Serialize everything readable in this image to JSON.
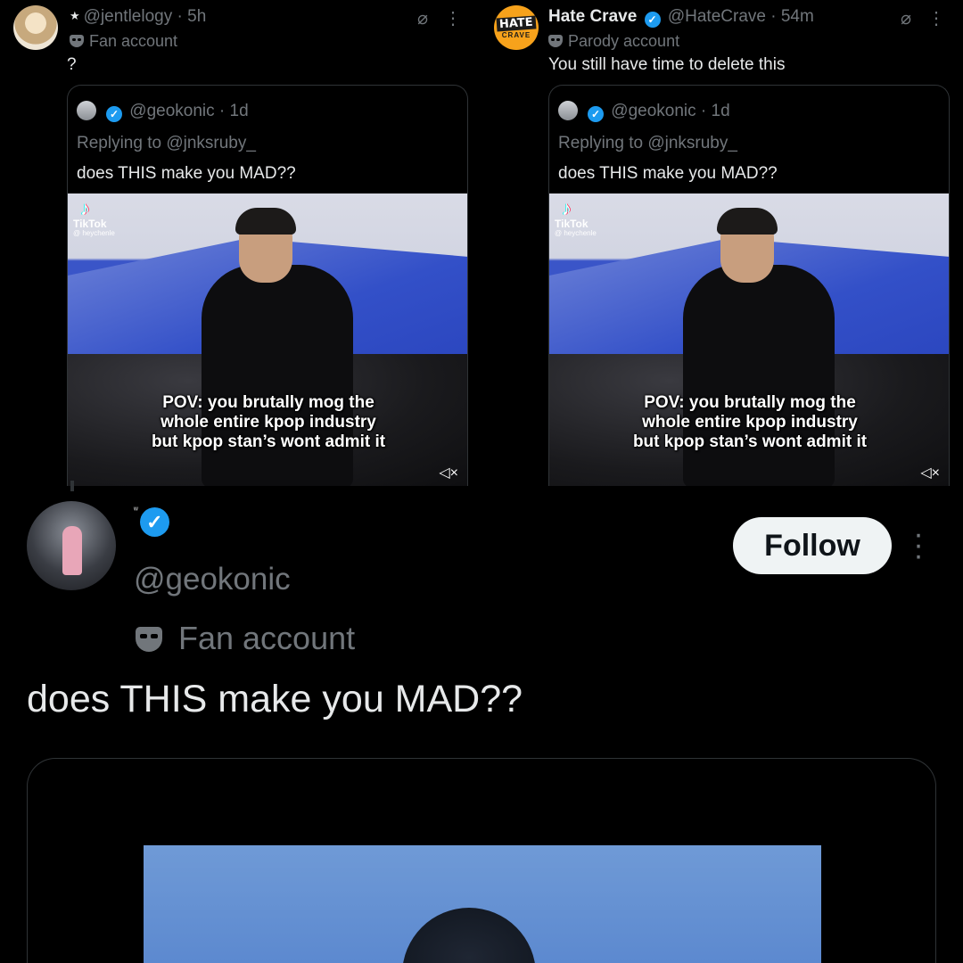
{
  "tweets": [
    {
      "display_name": "",
      "handle": "@jentlelogy",
      "time": "5h",
      "account_label": "Fan account",
      "text": "?",
      "quote": {
        "handle": "@geokonic",
        "time": "1d",
        "replying_to": "Replying to @jnksruby_",
        "text": "does THIS make you MAD??",
        "media": {
          "watermark_app": "TikTok",
          "watermark_handle": "@ heychenle",
          "caption_lines": [
            "POV: you brutally mog the",
            "whole entire kpop industry",
            "but kpop stan’s wont admit it"
          ]
        }
      }
    },
    {
      "display_name": "Hate Crave",
      "handle": "@HateCrave",
      "time": "54m",
      "account_label": "Parody account",
      "text": "You still have time to delete this",
      "logo_text": [
        "HATE",
        "CRAVE"
      ],
      "quote": {
        "handle": "@geokonic",
        "time": "1d",
        "replying_to": "Replying to @jnksruby_",
        "text": "does THIS make you MAD??",
        "media": {
          "watermark_app": "TikTok",
          "watermark_handle": "@ heychenle",
          "caption_lines": [
            "POV: you brutally mog the",
            "whole entire kpop industry",
            "but kpop stan’s wont admit it"
          ]
        }
      }
    }
  ],
  "main_tweet": {
    "handle": "@geokonic",
    "account_label": "Fan account",
    "text": "does THIS make you MAD??",
    "follow_label": "Follow"
  },
  "icons": {
    "grok": "⌀",
    "more": "⋮",
    "mute": "🔇",
    "verified": "✓"
  },
  "colors": {
    "background": "#000000",
    "text_primary": "#e7e9ea",
    "text_secondary": "#71767b",
    "verified": "#1d9bf0",
    "follow_bg": "#eff3f4",
    "hatecrave_brand": "#f7a21b"
  }
}
